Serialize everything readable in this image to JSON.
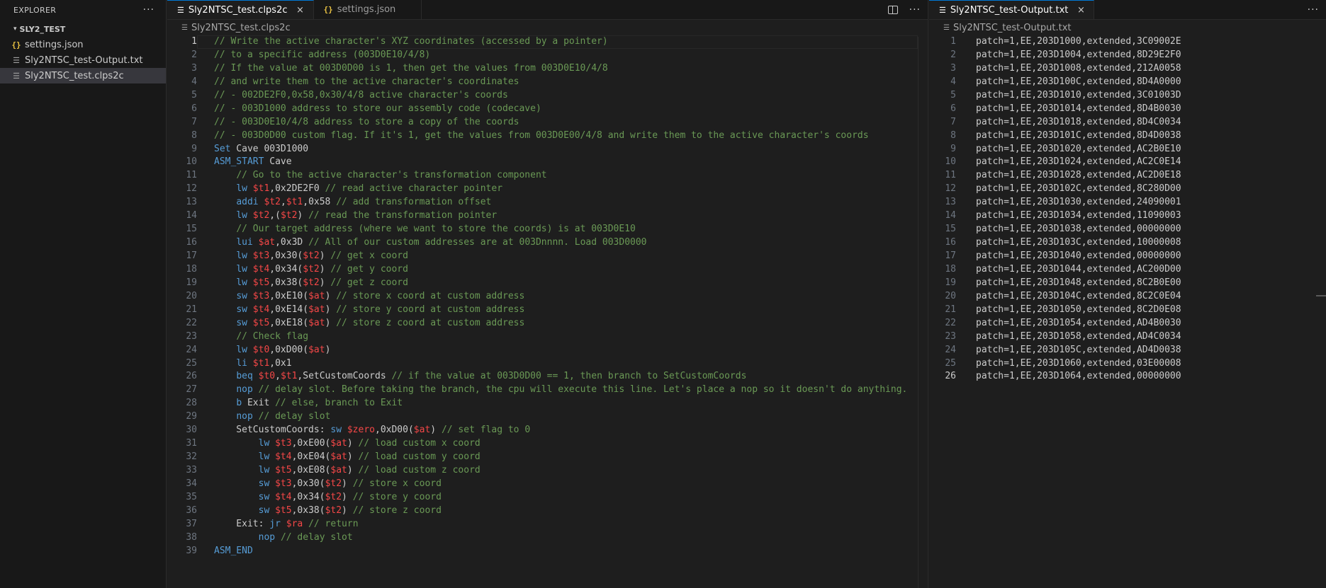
{
  "sidebar": {
    "title": "EXPLORER",
    "more": "···",
    "folder": "SLY2_TEST",
    "files": [
      {
        "name": "settings.json",
        "icon": "json-icon",
        "glyph": "{}"
      },
      {
        "name": "Sly2NTSC_test-Output.txt",
        "icon": "text-file-icon",
        "glyph": "☰"
      },
      {
        "name": "Sly2NTSC_test.clps2c",
        "icon": "text-file-icon",
        "glyph": "☰"
      }
    ]
  },
  "editor1": {
    "tabs": [
      {
        "label": "Sly2NTSC_test.clps2c",
        "glyph": "☰",
        "close": "×"
      },
      {
        "label": "settings.json",
        "glyph": "{}"
      }
    ],
    "more": "···",
    "breadcrumb": "Sly2NTSC_test.clps2c",
    "breadcrumb_glyph": "☰",
    "lines": [
      [
        [
          "c",
          "// Write the active character's XYZ coordinates (accessed by a pointer)"
        ]
      ],
      [
        [
          "c",
          "// to a specific address (003D0E10/4/8)"
        ]
      ],
      [
        [
          "c",
          "// If the value at 003D0D00 is 1, then get the values from 003D0E10/4/8"
        ]
      ],
      [
        [
          "c",
          "// and write them to the active character's coordinates"
        ]
      ],
      [
        [
          "c",
          "// - 002DE2F0,0x58,0x30/4/8 active character's coords"
        ]
      ],
      [
        [
          "c",
          "// - 003D1000 address to store our assembly code (codecave)"
        ]
      ],
      [
        [
          "c",
          "// - 003D0E10/4/8 address to store a copy of the coords"
        ]
      ],
      [
        [
          "c",
          "// - 003D0D00 custom flag. If it's 1, get the values from 003D0E00/4/8 and write them to the active character's coords"
        ]
      ],
      [
        [
          "k",
          "Set"
        ],
        [
          "t",
          " Cave 003D1000"
        ]
      ],
      [
        [
          "k",
          "ASM_START"
        ],
        [
          "t",
          " Cave"
        ]
      ],
      [
        [
          "t",
          "    "
        ],
        [
          "c",
          "// Go to the active character's transformation component"
        ]
      ],
      [
        [
          "t",
          "    "
        ],
        [
          "k",
          "lw"
        ],
        [
          "t",
          " "
        ],
        [
          "r",
          "$t1"
        ],
        [
          "t",
          ",0x2DE2F0 "
        ],
        [
          "c",
          "// read active character pointer"
        ]
      ],
      [
        [
          "t",
          "    "
        ],
        [
          "k",
          "addi"
        ],
        [
          "t",
          " "
        ],
        [
          "r",
          "$t2"
        ],
        [
          "t",
          ","
        ],
        [
          "r",
          "$t1"
        ],
        [
          "t",
          ",0x58 "
        ],
        [
          "c",
          "// add transformation offset"
        ]
      ],
      [
        [
          "t",
          "    "
        ],
        [
          "k",
          "lw"
        ],
        [
          "t",
          " "
        ],
        [
          "r",
          "$t2"
        ],
        [
          "t",
          ",("
        ],
        [
          "r",
          "$t2"
        ],
        [
          "t",
          ") "
        ],
        [
          "c",
          "// read the transformation pointer"
        ]
      ],
      [
        [
          "t",
          "    "
        ],
        [
          "c",
          "// Our target address (where we want to store the coords) is at 003D0E10"
        ]
      ],
      [
        [
          "t",
          "    "
        ],
        [
          "k",
          "lui"
        ],
        [
          "t",
          " "
        ],
        [
          "r",
          "$at"
        ],
        [
          "t",
          ",0x3D "
        ],
        [
          "c",
          "// All of our custom addresses are at 003Dnnnn. Load 003D0000"
        ]
      ],
      [
        [
          "t",
          "    "
        ],
        [
          "k",
          "lw"
        ],
        [
          "t",
          " "
        ],
        [
          "r",
          "$t3"
        ],
        [
          "t",
          ",0x30("
        ],
        [
          "r",
          "$t2"
        ],
        [
          "t",
          ") "
        ],
        [
          "c",
          "// get x coord"
        ]
      ],
      [
        [
          "t",
          "    "
        ],
        [
          "k",
          "lw"
        ],
        [
          "t",
          " "
        ],
        [
          "r",
          "$t4"
        ],
        [
          "t",
          ",0x34("
        ],
        [
          "r",
          "$t2"
        ],
        [
          "t",
          ") "
        ],
        [
          "c",
          "// get y coord"
        ]
      ],
      [
        [
          "t",
          "    "
        ],
        [
          "k",
          "lw"
        ],
        [
          "t",
          " "
        ],
        [
          "r",
          "$t5"
        ],
        [
          "t",
          ",0x38("
        ],
        [
          "r",
          "$t2"
        ],
        [
          "t",
          ") "
        ],
        [
          "c",
          "// get z coord"
        ]
      ],
      [
        [
          "t",
          "    "
        ],
        [
          "k",
          "sw"
        ],
        [
          "t",
          " "
        ],
        [
          "r",
          "$t3"
        ],
        [
          "t",
          ",0xE10("
        ],
        [
          "r",
          "$at"
        ],
        [
          "t",
          ") "
        ],
        [
          "c",
          "// store x coord at custom address"
        ]
      ],
      [
        [
          "t",
          "    "
        ],
        [
          "k",
          "sw"
        ],
        [
          "t",
          " "
        ],
        [
          "r",
          "$t4"
        ],
        [
          "t",
          ",0xE14("
        ],
        [
          "r",
          "$at"
        ],
        [
          "t",
          ") "
        ],
        [
          "c",
          "// store y coord at custom address"
        ]
      ],
      [
        [
          "t",
          "    "
        ],
        [
          "k",
          "sw"
        ],
        [
          "t",
          " "
        ],
        [
          "r",
          "$t5"
        ],
        [
          "t",
          ",0xE18("
        ],
        [
          "r",
          "$at"
        ],
        [
          "t",
          ") "
        ],
        [
          "c",
          "// store z coord at custom address"
        ]
      ],
      [
        [
          "t",
          "    "
        ],
        [
          "c",
          "// Check flag"
        ]
      ],
      [
        [
          "t",
          "    "
        ],
        [
          "k",
          "lw"
        ],
        [
          "t",
          " "
        ],
        [
          "r",
          "$t0"
        ],
        [
          "t",
          ",0xD00("
        ],
        [
          "r",
          "$at"
        ],
        [
          "t",
          ")"
        ]
      ],
      [
        [
          "t",
          "    "
        ],
        [
          "k",
          "li"
        ],
        [
          "t",
          " "
        ],
        [
          "r",
          "$t1"
        ],
        [
          "t",
          ",0x1"
        ]
      ],
      [
        [
          "t",
          "    "
        ],
        [
          "k",
          "beq"
        ],
        [
          "t",
          " "
        ],
        [
          "r",
          "$t0"
        ],
        [
          "t",
          ","
        ],
        [
          "r",
          "$t1"
        ],
        [
          "t",
          ",SetCustomCoords "
        ],
        [
          "c",
          "// if the value at 003D0D00 == 1, then branch to SetCustomCoords"
        ]
      ],
      [
        [
          "t",
          "    "
        ],
        [
          "k",
          "nop"
        ],
        [
          "t",
          " "
        ],
        [
          "c",
          "// delay slot. Before taking the branch, the cpu will execute this line. Let's place a nop so it doesn't do anything."
        ]
      ],
      [
        [
          "t",
          "    "
        ],
        [
          "k",
          "b"
        ],
        [
          "t",
          " Exit "
        ],
        [
          "c",
          "// else, branch to Exit"
        ]
      ],
      [
        [
          "t",
          "    "
        ],
        [
          "k",
          "nop"
        ],
        [
          "t",
          " "
        ],
        [
          "c",
          "// delay slot"
        ]
      ],
      [
        [
          "t",
          "    SetCustomCoords: "
        ],
        [
          "k",
          "sw"
        ],
        [
          "t",
          " "
        ],
        [
          "r",
          "$zero"
        ],
        [
          "t",
          ",0xD00("
        ],
        [
          "r",
          "$at"
        ],
        [
          "t",
          ") "
        ],
        [
          "c",
          "// set flag to 0"
        ]
      ],
      [
        [
          "t",
          "        "
        ],
        [
          "k",
          "lw"
        ],
        [
          "t",
          " "
        ],
        [
          "r",
          "$t3"
        ],
        [
          "t",
          ",0xE00("
        ],
        [
          "r",
          "$at"
        ],
        [
          "t",
          ") "
        ],
        [
          "c",
          "// load custom x coord"
        ]
      ],
      [
        [
          "t",
          "        "
        ],
        [
          "k",
          "lw"
        ],
        [
          "t",
          " "
        ],
        [
          "r",
          "$t4"
        ],
        [
          "t",
          ",0xE04("
        ],
        [
          "r",
          "$at"
        ],
        [
          "t",
          ") "
        ],
        [
          "c",
          "// load custom y coord"
        ]
      ],
      [
        [
          "t",
          "        "
        ],
        [
          "k",
          "lw"
        ],
        [
          "t",
          " "
        ],
        [
          "r",
          "$t5"
        ],
        [
          "t",
          ",0xE08("
        ],
        [
          "r",
          "$at"
        ],
        [
          "t",
          ") "
        ],
        [
          "c",
          "// load custom z coord"
        ]
      ],
      [
        [
          "t",
          "        "
        ],
        [
          "k",
          "sw"
        ],
        [
          "t",
          " "
        ],
        [
          "r",
          "$t3"
        ],
        [
          "t",
          ",0x30("
        ],
        [
          "r",
          "$t2"
        ],
        [
          "t",
          ") "
        ],
        [
          "c",
          "// store x coord"
        ]
      ],
      [
        [
          "t",
          "        "
        ],
        [
          "k",
          "sw"
        ],
        [
          "t",
          " "
        ],
        [
          "r",
          "$t4"
        ],
        [
          "t",
          ",0x34("
        ],
        [
          "r",
          "$t2"
        ],
        [
          "t",
          ") "
        ],
        [
          "c",
          "// store y coord"
        ]
      ],
      [
        [
          "t",
          "        "
        ],
        [
          "k",
          "sw"
        ],
        [
          "t",
          " "
        ],
        [
          "r",
          "$t5"
        ],
        [
          "t",
          ",0x38("
        ],
        [
          "r",
          "$t2"
        ],
        [
          "t",
          ") "
        ],
        [
          "c",
          "// store z coord"
        ]
      ],
      [
        [
          "t",
          "    Exit: "
        ],
        [
          "k",
          "jr"
        ],
        [
          "t",
          " "
        ],
        [
          "r",
          "$ra"
        ],
        [
          "t",
          " "
        ],
        [
          "c",
          "// return"
        ]
      ],
      [
        [
          "t",
          "        "
        ],
        [
          "k",
          "nop"
        ],
        [
          "t",
          " "
        ],
        [
          "c",
          "// delay slot"
        ]
      ],
      [
        [
          "k",
          "ASM_END"
        ]
      ]
    ]
  },
  "editor2": {
    "tabs": [
      {
        "label": "Sly2NTSC_test-Output.txt",
        "glyph": "☰",
        "close": "×"
      }
    ],
    "more": "···",
    "breadcrumb": "Sly2NTSC_test-Output.txt",
    "breadcrumb_glyph": "☰",
    "lines": [
      "patch=1,EE,203D1000,extended,3C09002E",
      "patch=1,EE,203D1004,extended,8D29E2F0",
      "patch=1,EE,203D1008,extended,212A0058",
      "patch=1,EE,203D100C,extended,8D4A0000",
      "patch=1,EE,203D1010,extended,3C01003D",
      "patch=1,EE,203D1014,extended,8D4B0030",
      "patch=1,EE,203D1018,extended,8D4C0034",
      "patch=1,EE,203D101C,extended,8D4D0038",
      "patch=1,EE,203D1020,extended,AC2B0E10",
      "patch=1,EE,203D1024,extended,AC2C0E14",
      "patch=1,EE,203D1028,extended,AC2D0E18",
      "patch=1,EE,203D102C,extended,8C280D00",
      "patch=1,EE,203D1030,extended,24090001",
      "patch=1,EE,203D1034,extended,11090003",
      "patch=1,EE,203D1038,extended,00000000",
      "patch=1,EE,203D103C,extended,10000008",
      "patch=1,EE,203D1040,extended,00000000",
      "patch=1,EE,203D1044,extended,AC200D00",
      "patch=1,EE,203D1048,extended,8C2B0E00",
      "patch=1,EE,203D104C,extended,8C2C0E04",
      "patch=1,EE,203D1050,extended,8C2D0E08",
      "patch=1,EE,203D1054,extended,AD4B0030",
      "patch=1,EE,203D1058,extended,AD4C0034",
      "patch=1,EE,203D105C,extended,AD4D0038",
      "patch=1,EE,203D1060,extended,03E00008",
      "patch=1,EE,203D1064,extended,00000000"
    ]
  },
  "colors": {
    "comment": "#6a9955",
    "keyword": "#569cd6",
    "register": "#f44747",
    "accent": "#0078d4"
  }
}
